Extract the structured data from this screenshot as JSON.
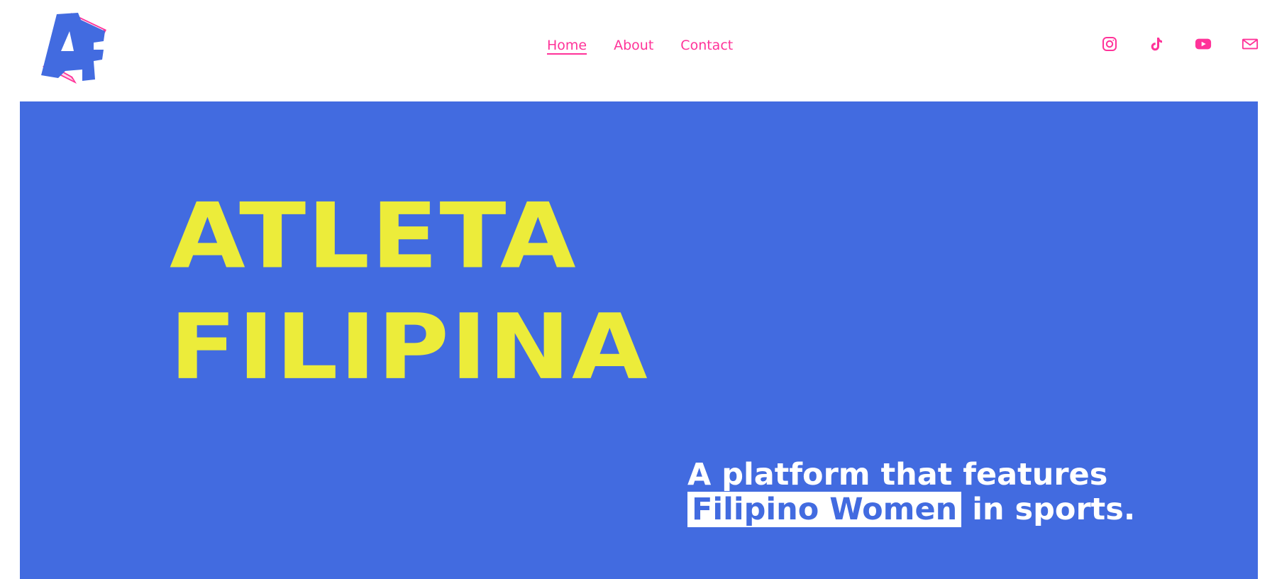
{
  "brand": {
    "logo_text": "AF",
    "logo_name": "atleta-filipina-logo"
  },
  "nav": {
    "items": [
      {
        "label": "Home",
        "active": true
      },
      {
        "label": "About",
        "active": false
      },
      {
        "label": "Contact",
        "active": false
      }
    ]
  },
  "socials": [
    {
      "icon": "instagram-icon"
    },
    {
      "icon": "tiktok-icon"
    },
    {
      "icon": "youtube-icon"
    },
    {
      "icon": "mail-icon"
    }
  ],
  "hero": {
    "title_line_1": "ATLETA",
    "title_line_2": "FILIPINA",
    "tagline_line_1": "A platform that features",
    "tagline_highlight": "Filipino Women",
    "tagline_rest": " in sports."
  },
  "colors": {
    "accent": "#ff3399",
    "hero_background": "#426be0",
    "title": "#ecec3a",
    "tagline": "#ffffff"
  }
}
